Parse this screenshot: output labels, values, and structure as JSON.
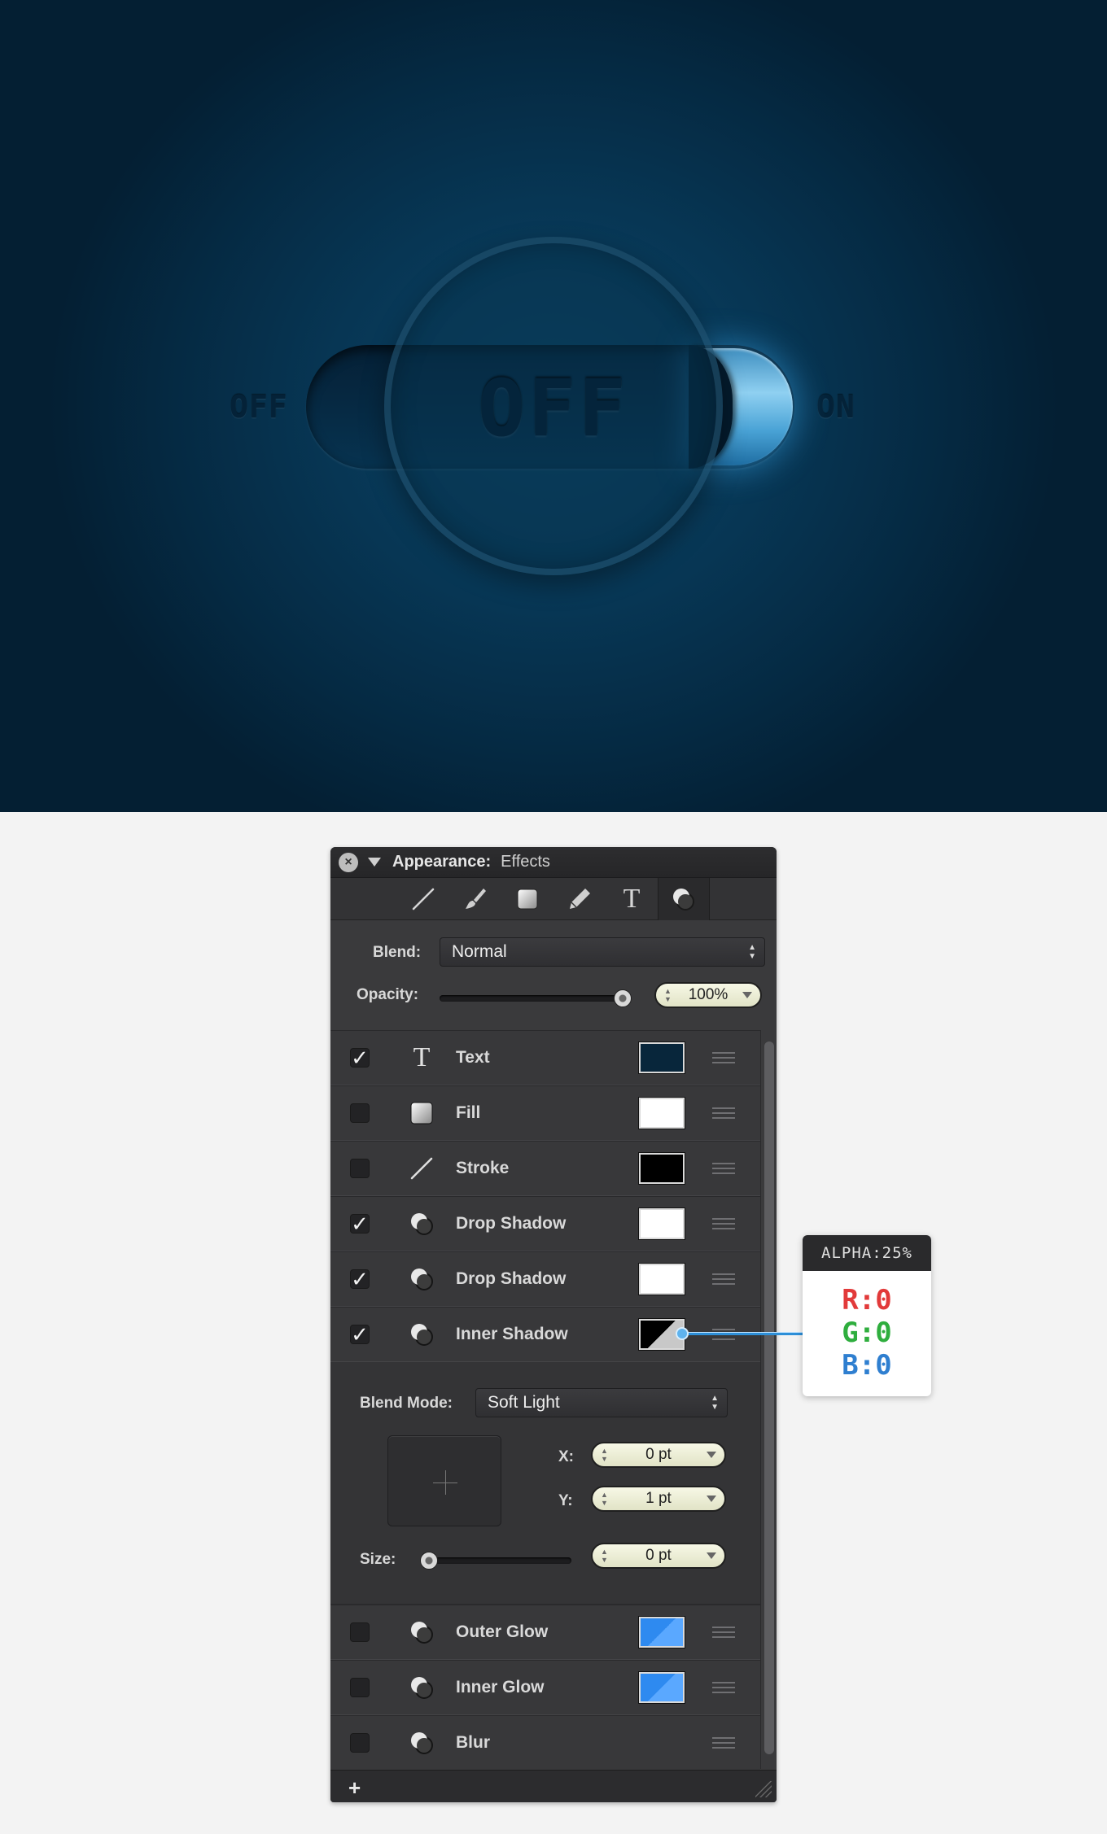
{
  "canvas": {
    "label_off": "OFF",
    "label_on": "ON",
    "center_label": "OFF",
    "switch_state_on": true
  },
  "panel": {
    "title_bold": "Appearance:",
    "title_light": "Effects",
    "toolbar": {
      "tools": [
        "line-tool-icon",
        "brush-tool-icon",
        "fill-tool-icon",
        "pen-tool-icon",
        "text-tool-icon",
        "effects-tool-icon"
      ],
      "text_glyph": "T",
      "active": "effects-tool-icon"
    },
    "blend": {
      "label": "Blend:",
      "value": "Normal"
    },
    "opacity": {
      "label": "Opacity:",
      "value": "100%",
      "level": 1.0
    },
    "effects": [
      {
        "label": "Text",
        "checked": true,
        "icon": "text-icon",
        "swatch": "#08263b"
      },
      {
        "label": "Fill",
        "checked": false,
        "icon": "fill-icon",
        "swatch": "#ffffff"
      },
      {
        "label": "Stroke",
        "checked": false,
        "icon": "stroke-icon",
        "swatch": "#000000"
      },
      {
        "label": "Drop Shadow",
        "checked": true,
        "icon": "shadow-icon",
        "swatch": "#ffffff"
      },
      {
        "label": "Drop Shadow",
        "checked": true,
        "icon": "shadow-icon",
        "swatch": "#ffffff"
      },
      {
        "label": "Inner Shadow",
        "checked": true,
        "icon": "shadow-icon",
        "swatch": "black-alpha"
      }
    ],
    "inner_shadow": {
      "blend_mode_label": "Blend Mode:",
      "blend_mode_value": "Soft Light",
      "x_label": "X:",
      "x_value": "0 pt",
      "y_label": "Y:",
      "y_value": "1 pt",
      "size_label": "Size:",
      "size_value": "0 pt",
      "size_level": 0.0
    },
    "effects_after": [
      {
        "label": "Outer Glow",
        "checked": false,
        "icon": "shadow-icon",
        "swatch": "blue-alpha"
      },
      {
        "label": "Inner Glow",
        "checked": false,
        "icon": "shadow-icon",
        "swatch": "blue-alpha"
      },
      {
        "label": "Blur",
        "checked": false,
        "icon": "shadow-icon",
        "swatch": null
      }
    ],
    "add_label": "+"
  },
  "tooltip": {
    "header": "ALPHA:25%",
    "r": "R:0",
    "g": "G:0",
    "b": "B:0"
  },
  "colors": {
    "canvas_bg": "#073654",
    "knob_on": "#5bb3e6",
    "panel_bg": "#3a3a3c",
    "glow_blue": "#2e8af0"
  }
}
